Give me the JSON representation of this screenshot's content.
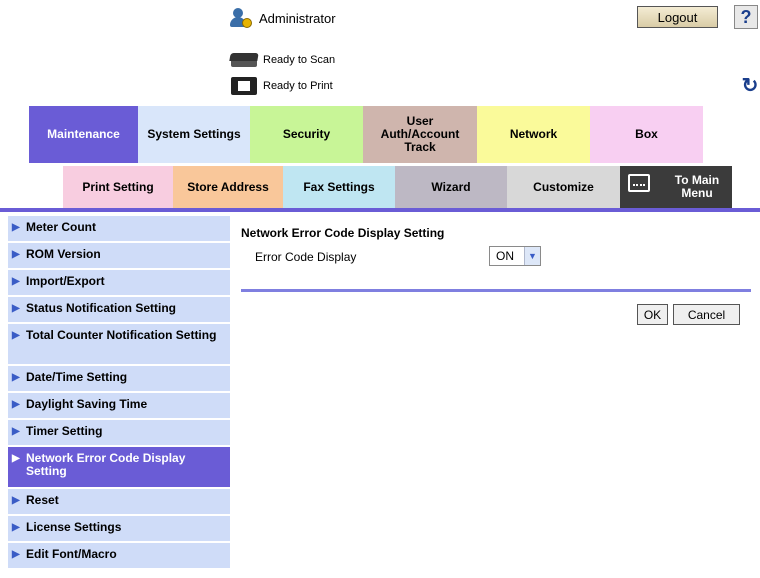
{
  "header": {
    "user_label": "Administrator",
    "logout_label": "Logout",
    "help_label": "?",
    "scan_status": "Ready to Scan",
    "print_status": "Ready to Print",
    "refresh_glyph": "↻"
  },
  "main_tabs": [
    {
      "label": "Maintenance",
      "active": true
    },
    {
      "label": "System Settings"
    },
    {
      "label": "Security"
    },
    {
      "label": "User Auth/Account Track"
    },
    {
      "label": "Network"
    },
    {
      "label": "Box"
    }
  ],
  "sub_tabs": [
    {
      "label": "Print Setting"
    },
    {
      "label": "Store Address"
    },
    {
      "label": "Fax Settings"
    },
    {
      "label": "Wizard"
    },
    {
      "label": "Customize"
    },
    {
      "label": "To Main Menu"
    }
  ],
  "sidebar": {
    "items": [
      {
        "label": "Meter Count"
      },
      {
        "label": "ROM Version"
      },
      {
        "label": "Import/Export"
      },
      {
        "label": "Status Notification Setting"
      },
      {
        "label": "Total Counter Notification Setting"
      },
      {
        "label": "Date/Time Setting"
      },
      {
        "label": "Daylight Saving Time"
      },
      {
        "label": "Timer Setting"
      },
      {
        "label": "Network Error Code Display Setting",
        "active": true
      },
      {
        "label": "Reset"
      },
      {
        "label": "License Settings"
      },
      {
        "label": "Edit Font/Macro"
      }
    ]
  },
  "content": {
    "title": "Network Error Code Display Setting",
    "field_label": "Error Code Display",
    "field_value": "ON",
    "ok_label": "OK",
    "cancel_label": "Cancel"
  },
  "colors": {
    "accent": "#6a5cd6",
    "sidebar_bg": "#cfdcf8"
  }
}
